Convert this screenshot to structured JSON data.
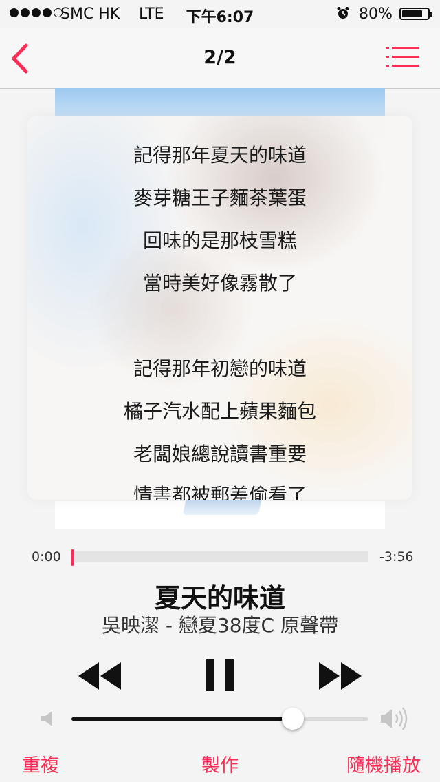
{
  "status_bar": {
    "carrier": "SMC HK",
    "network": "LTE",
    "time": "下午6:07",
    "battery_percent_label": "80%",
    "battery_level": 0.8,
    "signal_dots": [
      true,
      true,
      true,
      true,
      false
    ]
  },
  "nav": {
    "back_icon": "chevron-left-icon",
    "title": "2/2",
    "list_icon": "list-icon",
    "accent": "#ff2d55"
  },
  "lyrics": [
    "記得那年夏天的味道",
    "麥芽糖王子麵茶葉蛋",
    "回味的是那枝雪糕",
    "當時美好像霧散了",
    "",
    "記得那年初戀的味道",
    "橘子汽水配上蘋果麵包",
    "老闆娘總說讀書重要",
    "情書都被郵差偷看了"
  ],
  "player": {
    "elapsed": "0:00",
    "remaining": "-3:56",
    "progress": 0.0,
    "song_title": "夏天的味道",
    "artist_album": "吳映潔 - 戀夏38度C 原聲帶",
    "volume": 0.745
  },
  "bottom": {
    "repeat": "重複",
    "create": "製作",
    "shuffle": "隨機播放"
  }
}
